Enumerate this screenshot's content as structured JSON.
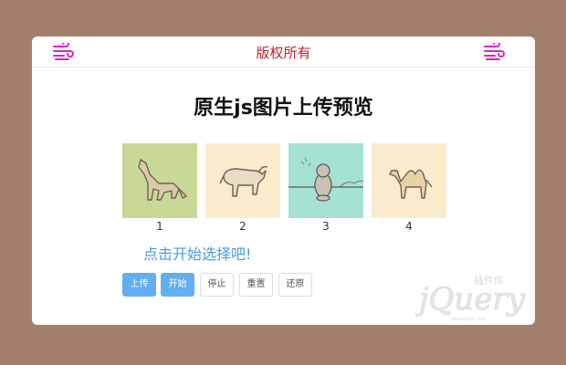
{
  "header": {
    "title": "版权所有",
    "left_icon": "wind-icon",
    "right_icon": "wind-icon",
    "accent_color": "#e020c8"
  },
  "main": {
    "heading": "原生js图片上传预览",
    "thumbnails": [
      {
        "number": "1",
        "icon": "wolf-icon",
        "bg": "#c8d896"
      },
      {
        "number": "2",
        "icon": "bull-icon",
        "bg": "#fbecce"
      },
      {
        "number": "3",
        "icon": "monkey-icon",
        "bg": "#a6e2d4"
      },
      {
        "number": "4",
        "icon": "camel-icon",
        "bg": "#fbecce"
      }
    ],
    "hint": "点击开始选择吧!",
    "buttons": [
      "上传",
      "开始",
      "停止",
      "重置",
      "还原"
    ]
  },
  "watermark": {
    "text": "jQuery",
    "sub": "插件库",
    "tagline": "www.jq22.com"
  }
}
